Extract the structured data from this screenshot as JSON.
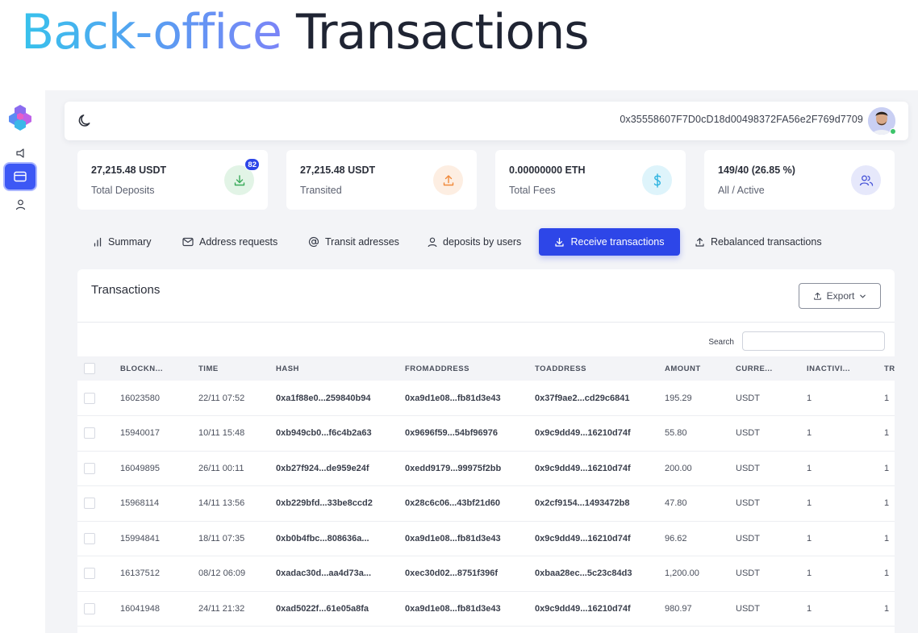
{
  "headline": {
    "accent": "Back-office",
    "rest": "Transactions"
  },
  "topbar": {
    "wallet_address": "0x35558607F7D0cD18d00498372FA56e2F769d7709"
  },
  "colors": {
    "primary": "#2d46e8",
    "accent_gradient_start": "#37c2ec",
    "accent_gradient_end": "#7b84f7",
    "online": "#3cc46a"
  },
  "stats": [
    {
      "value": "27,215.48 USDT",
      "label": "Total Deposits",
      "icon": "download-icon",
      "badge": "82"
    },
    {
      "value": "27,215.48 USDT",
      "label": "Transited",
      "icon": "upload-icon"
    },
    {
      "value": "0.00000000 ETH",
      "label": "Total Fees",
      "icon": "dollar-icon"
    },
    {
      "value": "149/40 (26.85 %)",
      "label": "All / Active",
      "icon": "users-icon"
    }
  ],
  "tabs": [
    {
      "label": "Summary",
      "icon": "bar-chart-icon"
    },
    {
      "label": "Address requests",
      "icon": "mail-icon"
    },
    {
      "label": "Transit adresses",
      "icon": "at-sign-icon"
    },
    {
      "label": "deposits by users",
      "icon": "user-icon"
    },
    {
      "label": "Receive transactions",
      "icon": "download-icon",
      "active": true
    },
    {
      "label": "Rebalanced transactions",
      "icon": "upload-icon"
    }
  ],
  "card": {
    "title": "Transactions",
    "export_label": "Export",
    "search_label": "Search",
    "search_value": ""
  },
  "table": {
    "columns": [
      "BLOCKN...",
      "TIME",
      "HASH",
      "FROMADDRESS",
      "TOADDRESS",
      "AMOUNT",
      "CURRE...",
      "INACTIVI...",
      "TR"
    ],
    "rows": [
      [
        "16023580",
        "22/11 07:52",
        "0xa1f88e0...259840b94",
        "0xa9d1e08...fb81d3e43",
        "0x37f9ae2...cd29c6841",
        "195.29",
        "USDT",
        "1",
        "1"
      ],
      [
        "15940017",
        "10/11 15:48",
        "0xb949cb0...f6c4b2a63",
        "0x9696f59...54bf96976",
        "0x9c9dd49...16210d74f",
        "55.80",
        "USDT",
        "1",
        "1"
      ],
      [
        "16049895",
        "26/11 00:11",
        "0xb27f924...de959e24f",
        "0xedd9179...99975f2bb",
        "0x9c9dd49...16210d74f",
        "200.00",
        "USDT",
        "1",
        "1"
      ],
      [
        "15968114",
        "14/11 13:56",
        "0xb229bfd...33be8ccd2",
        "0x28c6c06...43bf21d60",
        "0x2cf9154...1493472b8",
        "47.80",
        "USDT",
        "1",
        "1"
      ],
      [
        "15994841",
        "18/11 07:35",
        "0xb0b4fbc...808636a...",
        "0xa9d1e08...fb81d3e43",
        "0x9c9dd49...16210d74f",
        "96.62",
        "USDT",
        "1",
        "1"
      ],
      [
        "16137512",
        "08/12 06:09",
        "0xadac30d...aa4d73a...",
        "0xec30d02...8751f396f",
        "0xbaa28ec...5c23c84d3",
        "1,200.00",
        "USDT",
        "1",
        "1"
      ],
      [
        "16041948",
        "24/11 21:32",
        "0xad5022f...61e05a8fa",
        "0xa9d1e08...fb81d3e43",
        "0x9c9dd49...16210d74f",
        "980.97",
        "USDT",
        "1",
        "1"
      ]
    ]
  }
}
